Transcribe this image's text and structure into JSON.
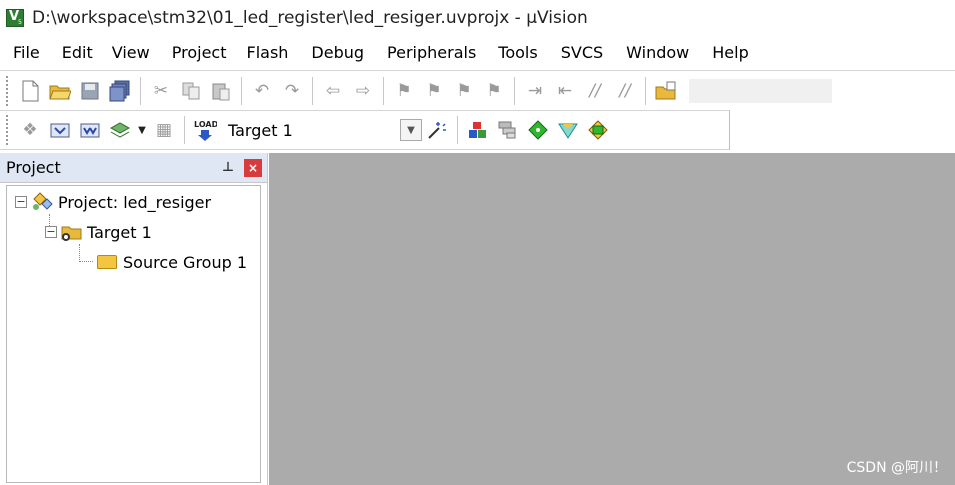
{
  "window": {
    "title": "D:\\workspace\\stm32\\01_led_register\\led_resiger.uvprojx - µVision"
  },
  "menu": [
    "File",
    "Edit",
    "View",
    "Project",
    "Flash",
    "Debug",
    "Peripherals",
    "Tools",
    "SVCS",
    "Window",
    "Help"
  ],
  "toolbar2": {
    "target_select": "Target 1"
  },
  "panel": {
    "title": "Project"
  },
  "tree": {
    "project": "Project: led_resiger",
    "target": "Target 1",
    "group": "Source Group 1"
  },
  "watermark": "CSDN @阿川！",
  "icons": [
    "new-file-icon",
    "open-folder-icon",
    "save-icon",
    "save-all-icon",
    "cut-icon",
    "copy-icon",
    "paste-icon",
    "undo-icon",
    "redo-icon",
    "nav-back-icon",
    "nav-forward-icon",
    "bookmark-icons",
    "indent-icon",
    "unindent-icon",
    "comment-icon",
    "uncomment-icon",
    "find-in-files-icon",
    "translate-icon",
    "build-icon",
    "rebuild-icon",
    "batch-build-icon",
    "stop-build-icon",
    "download-icon",
    "target-options-icon",
    "manage-project-icon",
    "select-packs-icon",
    "manage-rte-icon",
    "pack-installer-icon"
  ]
}
